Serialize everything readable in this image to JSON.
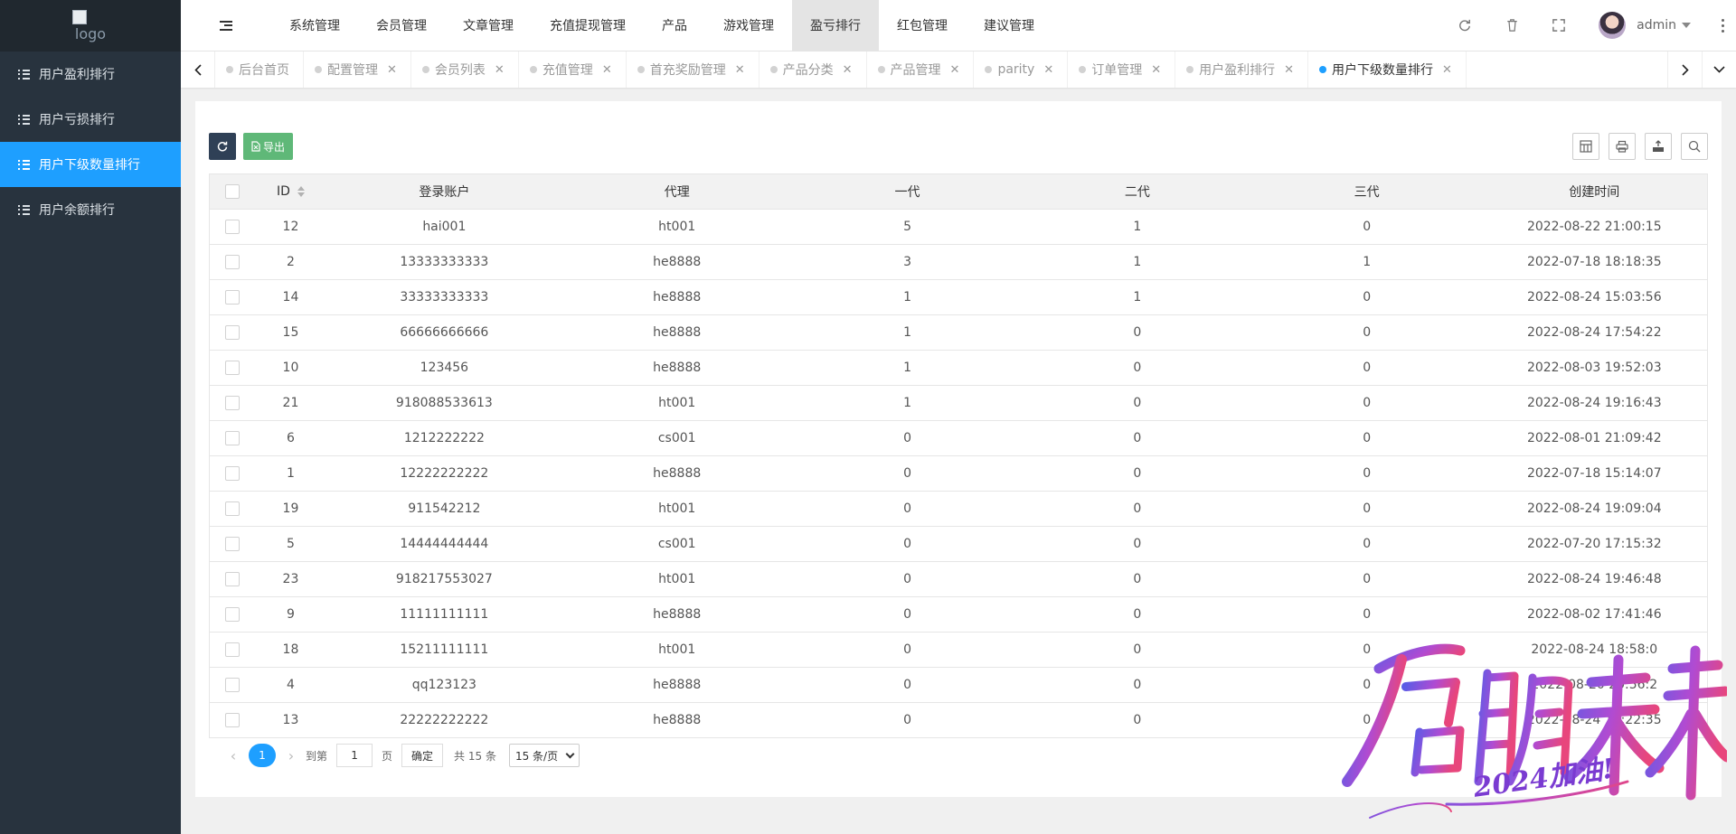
{
  "sidebar": {
    "logo_alt": "logo",
    "items": [
      {
        "label": "用户盈利排行",
        "active": false
      },
      {
        "label": "用户亏损排行",
        "active": false
      },
      {
        "label": "用户下级数量排行",
        "active": true
      },
      {
        "label": "用户余额排行",
        "active": false
      }
    ]
  },
  "header": {
    "nav": [
      "系统管理",
      "会员管理",
      "文章管理",
      "充值提现管理",
      "产品",
      "游戏管理",
      "盈亏排行",
      "红包管理",
      "建议管理"
    ],
    "active_nav": "盈亏排行",
    "icons": [
      "refresh-icon",
      "trash-icon",
      "fullscreen-icon"
    ],
    "username": "admin"
  },
  "tabs": [
    {
      "label": "后台首页",
      "closable": false,
      "active": false
    },
    {
      "label": "配置管理",
      "closable": true,
      "active": false
    },
    {
      "label": "会员列表",
      "closable": true,
      "active": false
    },
    {
      "label": "充值管理",
      "closable": true,
      "active": false
    },
    {
      "label": "首充奖励管理",
      "closable": true,
      "active": false
    },
    {
      "label": "产品分类",
      "closable": true,
      "active": false
    },
    {
      "label": "产品管理",
      "closable": true,
      "active": false
    },
    {
      "label": "parity",
      "closable": true,
      "active": false
    },
    {
      "label": "订单管理",
      "closable": true,
      "active": false
    },
    {
      "label": "用户盈利排行",
      "closable": true,
      "active": false
    },
    {
      "label": "用户下级数量排行",
      "closable": true,
      "active": true
    }
  ],
  "toolbar": {
    "export_label": "导出",
    "right_icons": [
      "columns-icon",
      "print-icon",
      "export-icon",
      "search-icon"
    ]
  },
  "table": {
    "columns": [
      "ID",
      "登录账户",
      "代理",
      "一代",
      "二代",
      "三代",
      "创建时间"
    ],
    "rows": [
      [
        "12",
        "hai001",
        "ht001",
        "5",
        "1",
        "0",
        "2022-08-22 21:00:15"
      ],
      [
        "2",
        "13333333333",
        "he8888",
        "3",
        "1",
        "1",
        "2022-07-18 18:18:35"
      ],
      [
        "14",
        "33333333333",
        "he8888",
        "1",
        "1",
        "0",
        "2022-08-24 15:03:56"
      ],
      [
        "15",
        "66666666666",
        "he8888",
        "1",
        "0",
        "0",
        "2022-08-24 17:54:22"
      ],
      [
        "10",
        "123456",
        "he8888",
        "1",
        "0",
        "0",
        "2022-08-03 19:52:03"
      ],
      [
        "21",
        "918088533613",
        "ht001",
        "1",
        "0",
        "0",
        "2022-08-24 19:16:43"
      ],
      [
        "6",
        "1212222222",
        "cs001",
        "0",
        "0",
        "0",
        "2022-08-01 21:09:42"
      ],
      [
        "1",
        "12222222222",
        "he8888",
        "0",
        "0",
        "0",
        "2022-07-18 15:14:07"
      ],
      [
        "19",
        "911542212",
        "ht001",
        "0",
        "0",
        "0",
        "2022-08-24 19:09:04"
      ],
      [
        "5",
        "14444444444",
        "cs001",
        "0",
        "0",
        "0",
        "2022-07-20 17:15:32"
      ],
      [
        "23",
        "918217553027",
        "ht001",
        "0",
        "0",
        "0",
        "2022-08-24 19:46:48"
      ],
      [
        "9",
        "11111111111",
        "he8888",
        "0",
        "0",
        "0",
        "2022-08-02 17:41:46"
      ],
      [
        "18",
        "15211111111",
        "ht001",
        "0",
        "0",
        "0",
        "2022-08-24 18:58:0"
      ],
      [
        "4",
        "qq123123",
        "he8888",
        "0",
        "0",
        "0",
        "2022-08-20 20:56:2"
      ],
      [
        "13",
        "22222222222",
        "he8888",
        "0",
        "0",
        "0",
        "2022-08-24 15:22:35"
      ]
    ]
  },
  "pager": {
    "current_page": "1",
    "goto_prefix": "到第",
    "goto_value": "1",
    "goto_suffix": "页",
    "confirm_label": "确定",
    "total_text": "共 15 条",
    "page_size": "15 条/页"
  },
  "watermark": {
    "title": "启航未来",
    "subtitle": "2024加油!"
  }
}
